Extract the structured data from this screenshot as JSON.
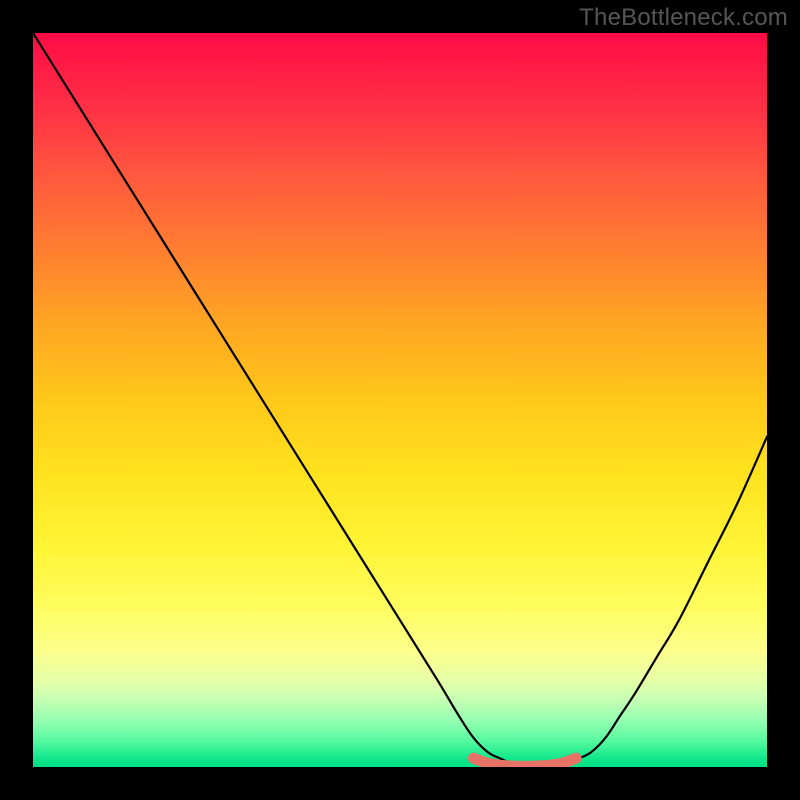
{
  "watermark": "TheBottleneck.com",
  "chart_data": {
    "type": "line",
    "title": "",
    "xlabel": "",
    "ylabel": "",
    "xlim": [
      0,
      100
    ],
    "ylim": [
      0,
      100
    ],
    "grid": false,
    "legend": false,
    "background_gradient": {
      "top": "#ff0b46",
      "mid": "#ffd31a",
      "bottom": "#00e085"
    },
    "series": [
      {
        "name": "bottleneck-curve",
        "color": "#000000",
        "x": [
          0,
          5,
          10,
          15,
          20,
          25,
          30,
          35,
          40,
          45,
          50,
          55,
          58,
          60,
          62,
          64,
          66,
          68,
          70,
          72,
          74,
          76,
          78,
          80,
          82,
          85,
          88,
          92,
          96,
          100
        ],
        "y": [
          100,
          92,
          84,
          76,
          68,
          60,
          52,
          44,
          36,
          28,
          20,
          12,
          7,
          4,
          2,
          1,
          0,
          0,
          0,
          0,
          1,
          2,
          4,
          7,
          10,
          15,
          20,
          28,
          36,
          45
        ]
      },
      {
        "name": "optimal-marker",
        "color": "#e77367",
        "x": [
          60,
          62,
          64,
          66,
          68,
          70,
          72,
          74
        ],
        "y": [
          1.2,
          0.5,
          0.2,
          0.1,
          0.1,
          0.2,
          0.5,
          1.2
        ]
      }
    ],
    "colors": {
      "curve": "#000000",
      "marker": "#e77367"
    }
  }
}
